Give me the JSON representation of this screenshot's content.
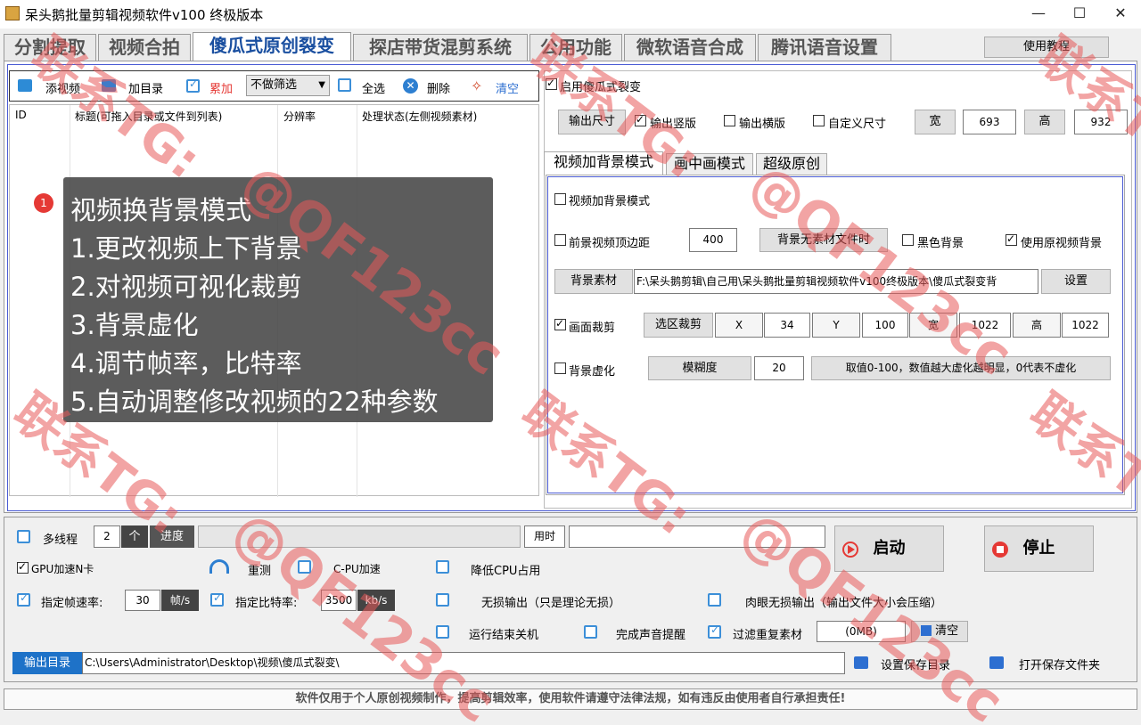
{
  "window": {
    "title": "呆头鹅批量剪辑视频软件v100 终极版本",
    "minimize": "—",
    "maximize": "☐",
    "close": "✕"
  },
  "main_tabs": [
    "分割提取",
    "视频合拍",
    "傻瓜式原创裂变",
    "探店带货混剪系统",
    "公用功能",
    "微软语音合成",
    "腾讯语音设置"
  ],
  "tutorial_button": "使用教程",
  "toolbar": {
    "add_video": "添视频",
    "add_dir": "加目录",
    "accumulate": "累加",
    "filter_value": "不做筛选",
    "select_all": "全选",
    "delete": "删除",
    "clear": "清空"
  },
  "table": {
    "columns": [
      "ID",
      "标题(可拖入目录或文件到列表)",
      "分辨率",
      "处理状态(左侧视频素材)"
    ]
  },
  "overlay": {
    "badge": "1",
    "lines": [
      "视频换背景模式",
      "1.更改视频上下背景",
      "2.对视频可视化裁剪",
      "3.背景虚化",
      "4.调节帧率，比特率",
      "5.自动调整修改视频的22种参数"
    ]
  },
  "right": {
    "enable_label": "启用傻瓜式裂变",
    "output_size": "输出尺寸",
    "output_vertical": "输出竖版",
    "output_horizontal": "输出横版",
    "custom_size": "自定义尺寸",
    "width_label": "宽",
    "width_value": "693",
    "height_label": "高",
    "height_value": "932",
    "subtabs": [
      "视频加背景模式",
      "画中画模式",
      "超级原创"
    ],
    "add_bg_mode": "视频加背景模式",
    "fg_top_margin": "前景视频顶边距",
    "fg_top_value": "400",
    "bg_no_file": "背景无素材文件时",
    "black_bg": "黑色背景",
    "use_orig_bg": "使用原视频背景",
    "bg_material": "背景素材",
    "bg_path": "F:\\呆头鹅剪辑\\自己用\\呆头鹅批量剪辑视频软件v100终极版本\\傻瓜式裂变背",
    "settings": "设置",
    "crop": "画面裁剪",
    "select_crop": "选区裁剪",
    "x_label": "X",
    "x_value": "34",
    "y_label": "Y",
    "y_value": "100",
    "cw_label": "宽",
    "cw_value": "1022",
    "ch_label": "高",
    "ch_value": "1022",
    "bg_blur": "背景虚化",
    "blur_degree": "模糊度",
    "blur_value": "20",
    "blur_hint": "取值0-100，数值越大虚化越明显，0代表不虚化"
  },
  "bottom": {
    "multithread": "多线程",
    "thread_count": "2",
    "thread_unit": "个",
    "progress": "进度",
    "progress_fraction": 0,
    "elapsed": "用时",
    "start": "启动",
    "stop": "停止",
    "gpu_accel": "GPU加速N卡",
    "retest": "重测",
    "cpu_accel": "C-PU加速",
    "lower_cpu": "降低CPU占用",
    "fps_label": "指定帧速率:",
    "fps_value": "30",
    "fps_unit": "帧/s",
    "bitrate_label": "指定比特率:",
    "bitrate_value": "3500",
    "bitrate_unit": "kb/s",
    "lossless": "无损输出（只是理论无损）",
    "visual_lossless": "肉眼无损输出（输出文件大小会压缩）",
    "shutdown": "运行结束关机",
    "sound_alert": "完成声音提醒",
    "filter_dup": "过滤重复素材",
    "dup_size": "(0MB)",
    "dup_clear": "清空",
    "output_dir_btn": "输出目录",
    "output_dir_value": "C:\\Users\\Administrator\\Desktop\\视频\\傻瓜式裂变\\",
    "set_save_dir": "设置保存目录",
    "open_save_dir": "打开保存文件夹"
  },
  "footer": "软件仅用于个人原创视频制作，提高剪辑效率，使用软件请遵守法律法规，如有违反由使用者自行承担责任!",
  "watermarks": [
    "联系TG:",
    "@QF123cc"
  ],
  "colors": {
    "accent_blue": "#1a4fa0",
    "frame_blue": "#4a5bd4",
    "watermark": "#e85a5a",
    "checkbox_blue": "#3c8fd8",
    "stop_red": "#e53935"
  }
}
